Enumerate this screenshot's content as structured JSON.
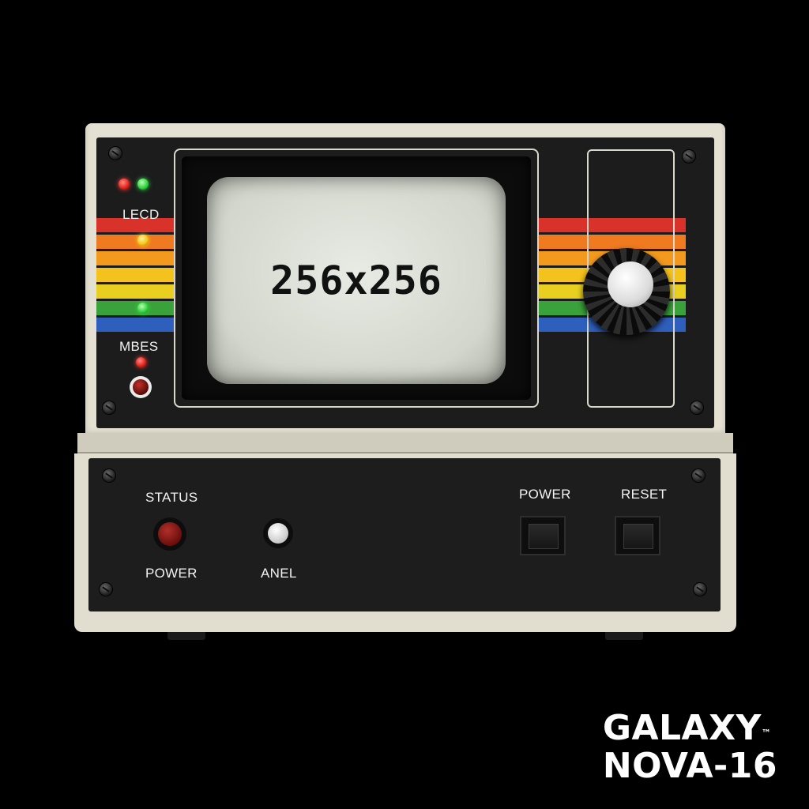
{
  "screen": {
    "text": "256x256"
  },
  "left_panel": {
    "label_top": "LECD",
    "label_bottom": "MBES"
  },
  "lower_panel": {
    "status_label": "STATUS",
    "power_label_left": "POWER",
    "anel_label": "ANEL",
    "power_button_label": "POWER",
    "reset_button_label": "RESET"
  },
  "brand": {
    "line1": "GALAXY",
    "trademark": "™",
    "line2": "NOVA-16"
  },
  "colors": {
    "body": "#e4e0d2",
    "panel": "#1c1c1d",
    "stripes": [
      "#d8322b",
      "#ef7a1f",
      "#f4c21c",
      "#3aa23a",
      "#2f5fbd"
    ]
  }
}
